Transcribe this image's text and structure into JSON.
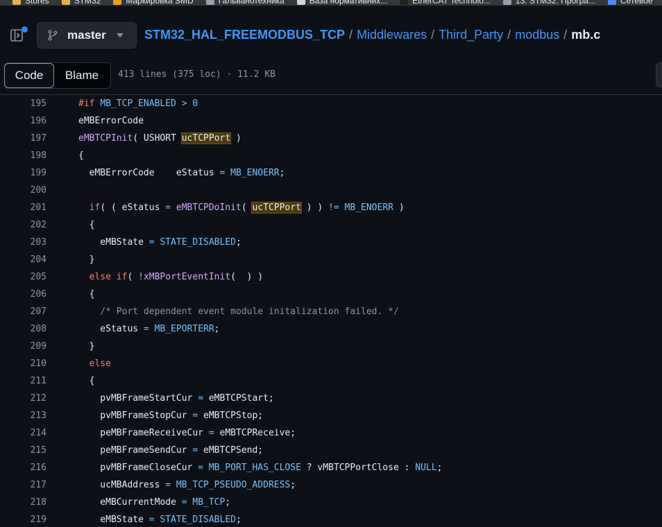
{
  "bookmarks": [
    {
      "label": "Stores",
      "icon": "folder-icon",
      "color": "#e0b44a"
    },
    {
      "label": "STM32",
      "icon": "folder-icon",
      "color": "#e0b44a"
    },
    {
      "label": "Маркировка SMD",
      "icon": "site-icon",
      "color": "#e5a31f"
    },
    {
      "label": "Гальванотехника",
      "icon": "globe-icon",
      "color": "#9aa0a6"
    },
    {
      "label": "База нормативних...",
      "icon": "doc-icon",
      "color": "#cfd8dc"
    },
    {
      "label": "EtherCAT Technolo...",
      "icon": "site-icon",
      "color": "#222222"
    },
    {
      "label": "13. STM32. Програ...",
      "icon": "tools-icon",
      "color": "#9aa0a6"
    },
    {
      "label": "Сетевое",
      "icon": "site-icon",
      "color": "#4c8bf5"
    }
  ],
  "header": {
    "branch": "master",
    "breadcrumb": {
      "repo": "STM32_HAL_FREEMODBUS_TCP",
      "folders": [
        "Middlewares",
        "Third_Party",
        "modbus"
      ],
      "file": "mb.c",
      "separator": "/"
    }
  },
  "toolbar": {
    "code_label": "Code",
    "blame_label": "Blame",
    "file_info": "413 lines (375 loc) · 11.2 KB"
  },
  "colors": {
    "background": "#0d1117",
    "link": "#4493f8",
    "keyword": "#ff7b72",
    "function": "#d2a8ff",
    "constant": "#79c0ff",
    "comment": "#8b949e",
    "highlight": "#4d3a0e"
  },
  "code": [
    {
      "n": "195",
      "tokens": [
        [
          "kw",
          "#if"
        ],
        [
          "txt",
          " "
        ],
        [
          "const",
          "MB_TCP_ENABLED"
        ],
        [
          "txt",
          " "
        ],
        [
          "op",
          ">"
        ],
        [
          "txt",
          " "
        ],
        [
          "const",
          "0"
        ]
      ]
    },
    {
      "n": "196",
      "tokens": [
        [
          "txt",
          "eMBErrorCode"
        ]
      ]
    },
    {
      "n": "197",
      "tokens": [
        [
          "fn",
          "eMBTCPInit"
        ],
        [
          "txt",
          "( USHORT "
        ],
        [
          "hl",
          "ucTCPPort"
        ],
        [
          "txt",
          " )"
        ]
      ]
    },
    {
      "n": "198",
      "tokens": [
        [
          "txt",
          "{"
        ]
      ]
    },
    {
      "n": "199",
      "tokens": [
        [
          "txt",
          "  eMBErrorCode    eStatus "
        ],
        [
          "op",
          "="
        ],
        [
          "txt",
          " "
        ],
        [
          "const",
          "MB_ENOERR"
        ],
        [
          "txt",
          ";"
        ]
      ]
    },
    {
      "n": "200",
      "tokens": []
    },
    {
      "n": "201",
      "tokens": [
        [
          "txt",
          "  "
        ],
        [
          "kw",
          "if"
        ],
        [
          "txt",
          "( ( eStatus "
        ],
        [
          "op",
          "="
        ],
        [
          "txt",
          " "
        ],
        [
          "fn",
          "eMBTCPDoInit"
        ],
        [
          "txt",
          "( "
        ],
        [
          "hl",
          "ucTCPPort"
        ],
        [
          "txt",
          " ) ) "
        ],
        [
          "op",
          "!="
        ],
        [
          "txt",
          " "
        ],
        [
          "const",
          "MB_ENOERR"
        ],
        [
          "txt",
          " )"
        ]
      ]
    },
    {
      "n": "202",
      "tokens": [
        [
          "txt",
          "  {"
        ]
      ]
    },
    {
      "n": "203",
      "tokens": [
        [
          "txt",
          "    eMBState "
        ],
        [
          "op",
          "="
        ],
        [
          "txt",
          " "
        ],
        [
          "const",
          "STATE_DISABLED"
        ],
        [
          "txt",
          ";"
        ]
      ]
    },
    {
      "n": "204",
      "tokens": [
        [
          "txt",
          "  }"
        ]
      ]
    },
    {
      "n": "205",
      "tokens": [
        [
          "txt",
          "  "
        ],
        [
          "kw",
          "else"
        ],
        [
          "txt",
          " "
        ],
        [
          "kw",
          "if"
        ],
        [
          "txt",
          "( "
        ],
        [
          "op",
          "!"
        ],
        [
          "fn",
          "xMBPortEventInit"
        ],
        [
          "txt",
          "(  ) )"
        ]
      ]
    },
    {
      "n": "206",
      "tokens": [
        [
          "txt",
          "  {"
        ]
      ]
    },
    {
      "n": "207",
      "tokens": [
        [
          "txt",
          "    "
        ],
        [
          "com",
          "/* Port dependent event module initalization failed. */"
        ]
      ]
    },
    {
      "n": "208",
      "tokens": [
        [
          "txt",
          "    eStatus "
        ],
        [
          "op",
          "="
        ],
        [
          "txt",
          " "
        ],
        [
          "const",
          "MB_EPORTERR"
        ],
        [
          "txt",
          ";"
        ]
      ]
    },
    {
      "n": "209",
      "tokens": [
        [
          "txt",
          "  }"
        ]
      ]
    },
    {
      "n": "210",
      "tokens": [
        [
          "txt",
          "  "
        ],
        [
          "kw",
          "else"
        ]
      ]
    },
    {
      "n": "211",
      "tokens": [
        [
          "txt",
          "  {"
        ]
      ]
    },
    {
      "n": "212",
      "tokens": [
        [
          "txt",
          "    pvMBFrameStartCur "
        ],
        [
          "op",
          "="
        ],
        [
          "txt",
          " eMBTCPStart;"
        ]
      ]
    },
    {
      "n": "213",
      "tokens": [
        [
          "txt",
          "    pvMBFrameStopCur "
        ],
        [
          "op",
          "="
        ],
        [
          "txt",
          " eMBTCPStop;"
        ]
      ]
    },
    {
      "n": "214",
      "tokens": [
        [
          "txt",
          "    peMBFrameReceiveCur "
        ],
        [
          "op",
          "="
        ],
        [
          "txt",
          " eMBTCPReceive;"
        ]
      ]
    },
    {
      "n": "215",
      "tokens": [
        [
          "txt",
          "    peMBFrameSendCur "
        ],
        [
          "op",
          "="
        ],
        [
          "txt",
          " eMBTCPSend;"
        ]
      ]
    },
    {
      "n": "216",
      "tokens": [
        [
          "txt",
          "    pvMBFrameCloseCur "
        ],
        [
          "op",
          "="
        ],
        [
          "txt",
          " "
        ],
        [
          "const",
          "MB_PORT_HAS_CLOSE"
        ],
        [
          "txt",
          " ? vMBTCPPortClose : "
        ],
        [
          "const",
          "NULL"
        ],
        [
          "txt",
          ";"
        ]
      ]
    },
    {
      "n": "217",
      "tokens": [
        [
          "txt",
          "    ucMBAddress "
        ],
        [
          "op",
          "="
        ],
        [
          "txt",
          " "
        ],
        [
          "const",
          "MB_TCP_PSEUDO_ADDRESS"
        ],
        [
          "txt",
          ";"
        ]
      ]
    },
    {
      "n": "218",
      "tokens": [
        [
          "txt",
          "    eMBCurrentMode "
        ],
        [
          "op",
          "="
        ],
        [
          "txt",
          " "
        ],
        [
          "const",
          "MB_TCP"
        ],
        [
          "txt",
          ";"
        ]
      ]
    },
    {
      "n": "219",
      "tokens": [
        [
          "txt",
          "    eMBState "
        ],
        [
          "op",
          "="
        ],
        [
          "txt",
          " "
        ],
        [
          "const",
          "STATE_DISABLED"
        ],
        [
          "txt",
          ";"
        ]
      ]
    }
  ]
}
